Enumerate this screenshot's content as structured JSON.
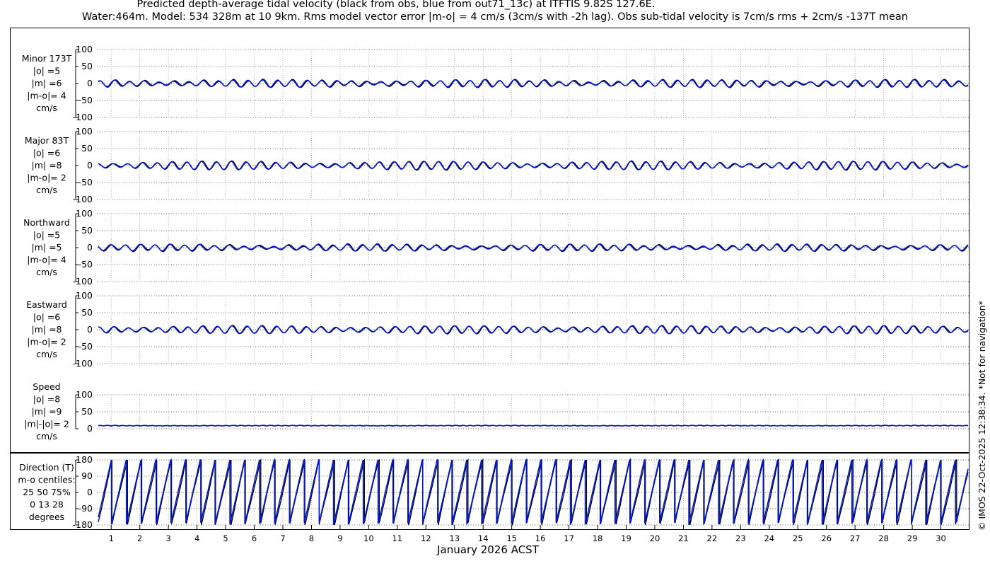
{
  "title_line1": "Predicted depth-average tidal velocity (black from obs, blue from out71_13c) at ITFTIS 9.82S 127.6E.",
  "title_line2": "Water:464m. Model: 534 328m at 10 9km. Rms model vector error |m-o| = 4 cm/s (3cm/s with -2h lag). Obs sub-tidal velocity is 7cm/s rms + 2cm/s -137T mean",
  "credit": "© IMOS 22-Oct-2025 12:38:34. *Not for navigation*",
  "xlabel": "January 2026 ACST",
  "colors": {
    "obs": "#000000",
    "model": "#0018d8",
    "grid": "#9a9a9a"
  },
  "chart_data": [
    {
      "type": "line",
      "label_lines": [
        "Minor 173T",
        "|o| =5",
        "|m| =6",
        "|m-o|= 4",
        "cm/s"
      ],
      "yticks": [
        "100",
        "50",
        "0",
        "-50",
        "-100"
      ],
      "ylim": [
        -100,
        100
      ],
      "amp": 10,
      "phase": 0.3,
      "mod": 0.5,
      "rough": 3,
      "series": []
    },
    {
      "type": "line",
      "label_lines": [
        "Major 83T",
        "|o| =6",
        "|m| =8",
        "|m-o|= 2",
        "cm/s"
      ],
      "yticks": [
        "100",
        "50",
        "0",
        "-50",
        "-100"
      ],
      "ylim": [
        -100,
        100
      ],
      "amp": 12,
      "phase": 1.1,
      "mod": 0.6,
      "rough": 2,
      "series": []
    },
    {
      "type": "line",
      "label_lines": [
        "Northward",
        "|o| =5",
        "|m| =5",
        "|m-o|= 4",
        "cm/s"
      ],
      "yticks": [
        "100",
        "50",
        "0",
        "-50",
        "-100"
      ],
      "ylim": [
        -100,
        100
      ],
      "amp": 9,
      "phase": 2.0,
      "mod": 0.55,
      "rough": 3,
      "series": []
    },
    {
      "type": "line",
      "label_lines": [
        "Eastward",
        "|o| =6",
        "|m| =8",
        "|m-o|= 2",
        "cm/s"
      ],
      "yticks": [
        "100",
        "50",
        "0",
        "-50",
        "-100"
      ],
      "ylim": [
        -100,
        100
      ],
      "amp": 11,
      "phase": 0.7,
      "mod": 0.5,
      "rough": 2,
      "series": []
    },
    {
      "type": "line",
      "label_lines": [
        "Speed",
        "|o| =8",
        "|m| =9",
        "|m|-|o|= 2",
        "cm/s"
      ],
      "yticks": [
        "100",
        "50",
        "0"
      ],
      "ylim": [
        0,
        100
      ],
      "amp": 4,
      "phase": 0.2,
      "mod": 0.4,
      "rough": 1,
      "offset": 8,
      "series": []
    },
    {
      "type": "line",
      "label_lines": [
        "Direction (T)",
        "m-o centiles:",
        "25  50  75%",
        "0  13  28",
        "degrees"
      ],
      "yticks": [
        "180",
        "90",
        "0",
        "-90",
        "-180"
      ],
      "ylim": [
        -180,
        180
      ],
      "wrapped": true,
      "series": []
    }
  ],
  "x": {
    "days": [
      "1",
      "2",
      "3",
      "4",
      "5",
      "6",
      "7",
      "8",
      "9",
      "10",
      "11",
      "12",
      "13",
      "14",
      "15",
      "16",
      "17",
      "18",
      "19",
      "20",
      "21",
      "22",
      "23",
      "24",
      "25",
      "26",
      "27",
      "28",
      "29",
      "30"
    ],
    "xlim": [
      0.5,
      31
    ]
  }
}
